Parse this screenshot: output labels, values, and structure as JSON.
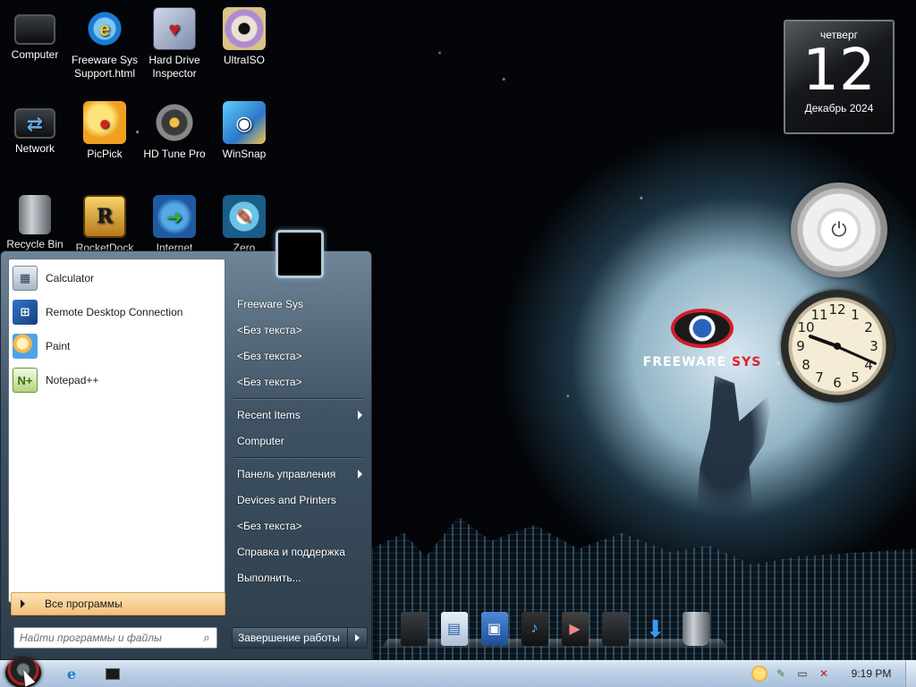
{
  "desktop": {
    "icons": [
      {
        "label": "Computer",
        "icon": "monitor-icon"
      },
      {
        "label": "Freeware Sys Support.html",
        "icon": "internet-explorer-icon"
      },
      {
        "label": "Hard Drive Inspector",
        "icon": "hard-drive-icon"
      },
      {
        "label": "UltraISO",
        "icon": "disc-icon"
      },
      {
        "label": "Network",
        "icon": "network-icon"
      },
      {
        "label": "PicPick",
        "icon": "palette-icon"
      },
      {
        "label": "HD Tune Pro",
        "icon": "hdd-tune-icon"
      },
      {
        "label": "WinSnap",
        "icon": "camera-snap-icon"
      },
      {
        "label": "Recycle Bin",
        "icon": "recycle-bin-icon"
      },
      {
        "label": "RocketDock",
        "icon": "rocketdock-icon"
      },
      {
        "label": "Internet",
        "icon": "download-manager-icon"
      },
      {
        "label": "Zero",
        "icon": "zero-tool-icon"
      }
    ],
    "brand": {
      "name_white": "FREEWARE",
      "name_red": "SYS"
    }
  },
  "gadgets": {
    "calendar": {
      "weekday": "четверг",
      "day": "12",
      "month_year": "Декабрь 2024"
    },
    "clock": {
      "numerals": [
        "12",
        "1",
        "2",
        "3",
        "4",
        "5",
        "6",
        "7",
        "8",
        "9",
        "10",
        "11"
      ]
    }
  },
  "start_menu": {
    "programs": [
      {
        "label": "Calculator",
        "icon": "calculator-icon"
      },
      {
        "label": "Remote Desktop Connection",
        "icon": "remote-desktop-icon"
      },
      {
        "label": "Paint",
        "icon": "paint-icon"
      },
      {
        "label": "Notepad++",
        "icon": "notepad-plus-plus-icon"
      }
    ],
    "all_programs": "Все программы",
    "search_placeholder": "Найти программы и файлы",
    "places": [
      {
        "label": "Freeware Sys",
        "submenu": false
      },
      {
        "label": "<Без текста>",
        "submenu": false
      },
      {
        "label": "<Без текста>",
        "submenu": false
      },
      {
        "label": "<Без текста>",
        "submenu": false
      },
      {
        "label": "Recent Items",
        "submenu": true
      },
      {
        "label": "Computer",
        "submenu": false
      },
      {
        "label": "Панель управления",
        "submenu": true
      },
      {
        "label": "Devices and Printers",
        "submenu": false
      },
      {
        "label": "<Без текста>",
        "submenu": false
      },
      {
        "label": "Справка и поддержка",
        "submenu": false
      },
      {
        "label": "Выполнить...",
        "submenu": false
      }
    ],
    "shutdown_label": "Завершение работы"
  },
  "taskbar": {
    "time": "9:19 PM"
  }
}
